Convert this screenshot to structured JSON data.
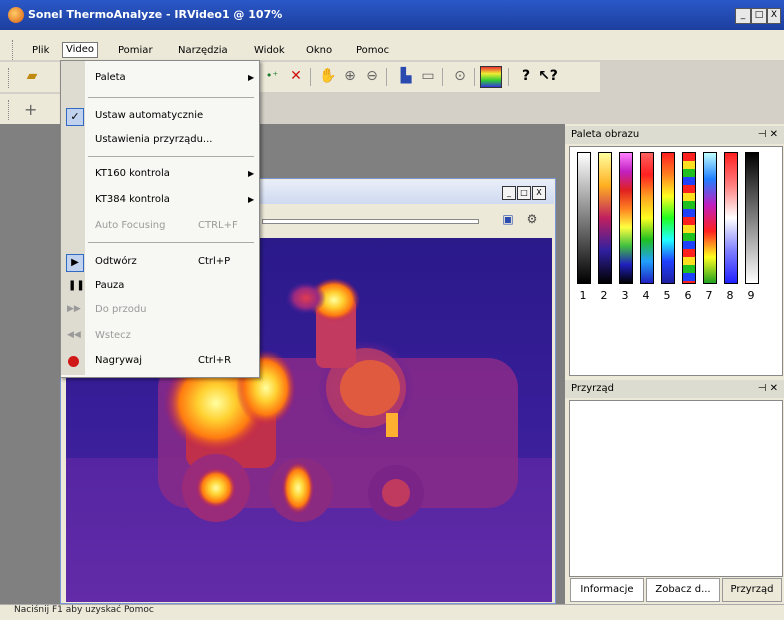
{
  "window": {
    "title": "Sonel ThermoAnalyze - IRVideo1 @ 107%",
    "controls": [
      "_",
      "□",
      "X"
    ]
  },
  "menubar": {
    "items": [
      "Plik",
      "Video",
      "Pomiar",
      "Narzędzia",
      "Widok",
      "Okno",
      "Pomoc"
    ]
  },
  "video_menu": {
    "items": [
      {
        "label": "Paleta",
        "shortcut": "",
        "submenu": true
      },
      {
        "label": "Ustaw automatycznie",
        "shortcut": "",
        "checked": true
      },
      {
        "label": "Ustawienia przyrządu...",
        "shortcut": ""
      },
      {
        "label": "KT160 kontrola",
        "shortcut": "",
        "submenu": true
      },
      {
        "label": "KT384 kontrola",
        "shortcut": "",
        "submenu": true
      },
      {
        "label": "Auto Focusing",
        "shortcut": "CTRL+F",
        "disabled": true
      },
      {
        "label": "Odtwórz",
        "shortcut": "Ctrl+P",
        "icon": "play-icon"
      },
      {
        "label": "Pauza",
        "shortcut": "",
        "icon": "pause-icon"
      },
      {
        "label": "Do przodu",
        "shortcut": "",
        "icon": "forward-icon",
        "disabled": true
      },
      {
        "label": "Wstecz",
        "shortcut": "",
        "icon": "rewind-icon",
        "disabled": true
      },
      {
        "label": "Nagrywaj",
        "shortcut": "Ctrl+R",
        "icon": "record-icon"
      }
    ]
  },
  "child_window": {
    "controls": [
      "_",
      "□",
      "X"
    ]
  },
  "palette_panel": {
    "title": "Paleta obrazu",
    "palettes": [
      "1",
      "2",
      "3",
      "4",
      "5",
      "6",
      "7",
      "8",
      "9"
    ]
  },
  "instrument_panel": {
    "title": "Przyrząd"
  },
  "right_tabs": [
    "Informacje",
    "Zobacz d...",
    "Przyrząd"
  ],
  "statusbar": {
    "text": "Naciśnij F1 aby uzyskać Pomoc"
  },
  "colors": {
    "title_bar": "#1d3f9e",
    "thermal_background": "#2a1a8a",
    "thermal_hot": "#ffdd33"
  }
}
